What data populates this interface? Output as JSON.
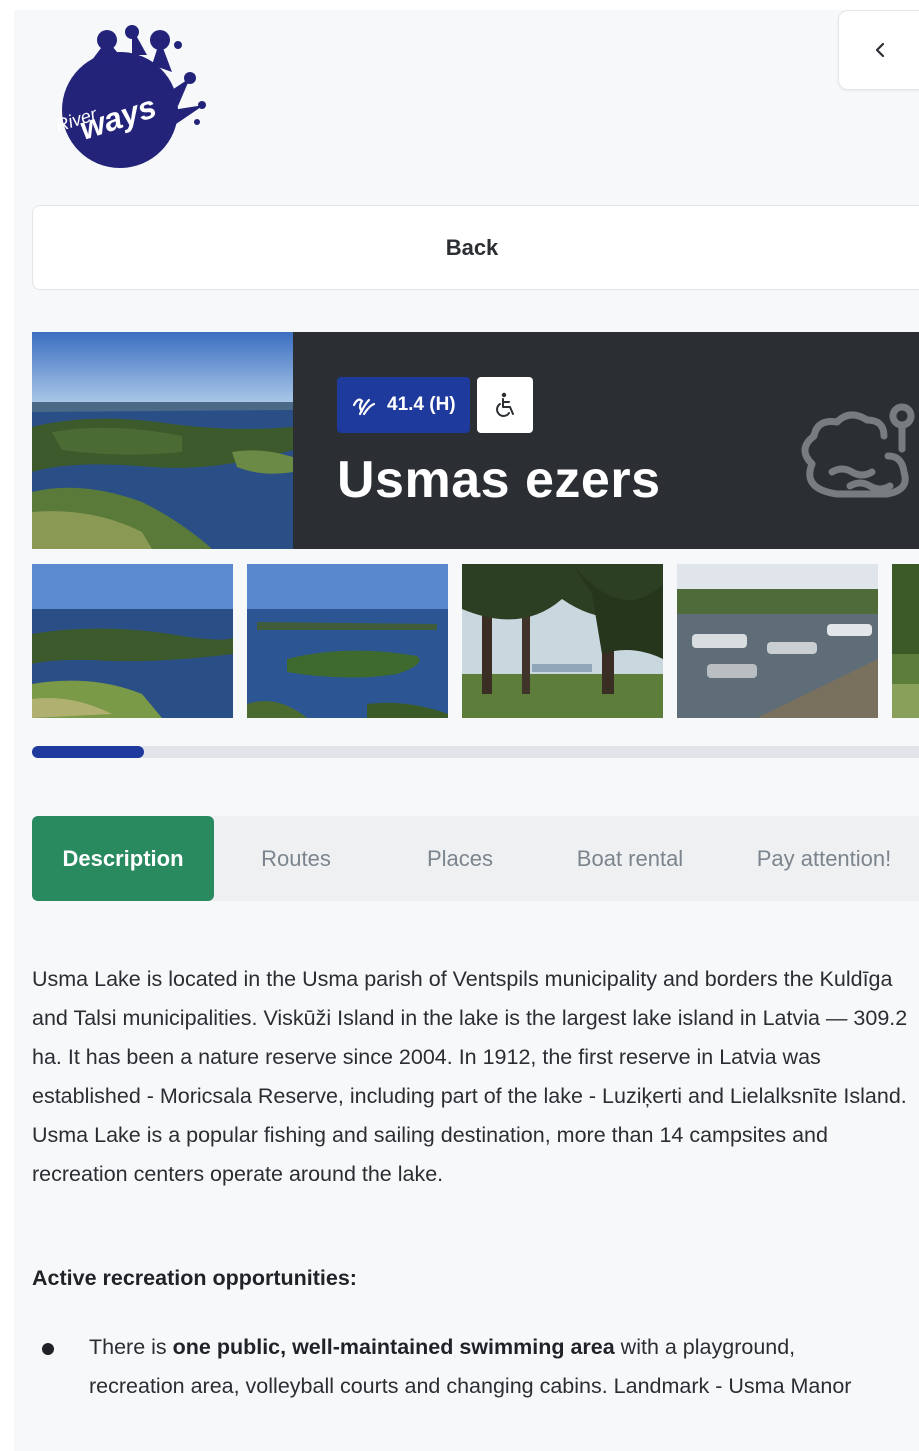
{
  "logo": {
    "text_top": "River",
    "text_main": "ways"
  },
  "header": {
    "collapse_icon": "chevron-left-icon"
  },
  "back_button": {
    "label": "Back"
  },
  "hero": {
    "level_badge": "41.4 (H)",
    "level_icon": "water-level-icon",
    "accessibility_icon": "wheelchair-icon",
    "title": "Usmas ezers",
    "decor_icon": "lake-icon"
  },
  "gallery": {
    "thumbnail_count": 5,
    "scroll_progress": 0.12
  },
  "tabs": [
    {
      "label": "Description",
      "active": true
    },
    {
      "label": "Routes",
      "active": false
    },
    {
      "label": "Places",
      "active": false
    },
    {
      "label": "Boat rental",
      "active": false
    },
    {
      "label": "Pay attention!",
      "active": false
    }
  ],
  "content": {
    "description": "Usma Lake is located in the Usma parish of Ventspils municipality and borders the Kuldīga and Talsi municipalities. Viskūži Island in the lake is the largest lake island in Latvia — 309.2 ha. It has been a nature reserve since 2004. In 1912, the first reserve in Latvia was established - Moricsala Reserve, including part of the lake - Luziķerti and Lielalksnīte Island. Usma Lake is a popular fishing and sailing destination, more than 14 campsites and recreation centers operate around the lake.",
    "subheading": "Active recreation opportunities:",
    "bullets": [
      {
        "before": "There is ",
        "bold": "one public, well-maintained swimming area",
        "after": " with a playground, recreation area, volleyball courts and changing cabins. Landmark - Usma Manor"
      }
    ]
  },
  "colors": {
    "brand_blue": "#1e3a9c",
    "active_tab": "#2a8a5f",
    "hero_bg": "#2b2e33",
    "page_bg": "#f7f8fa"
  }
}
